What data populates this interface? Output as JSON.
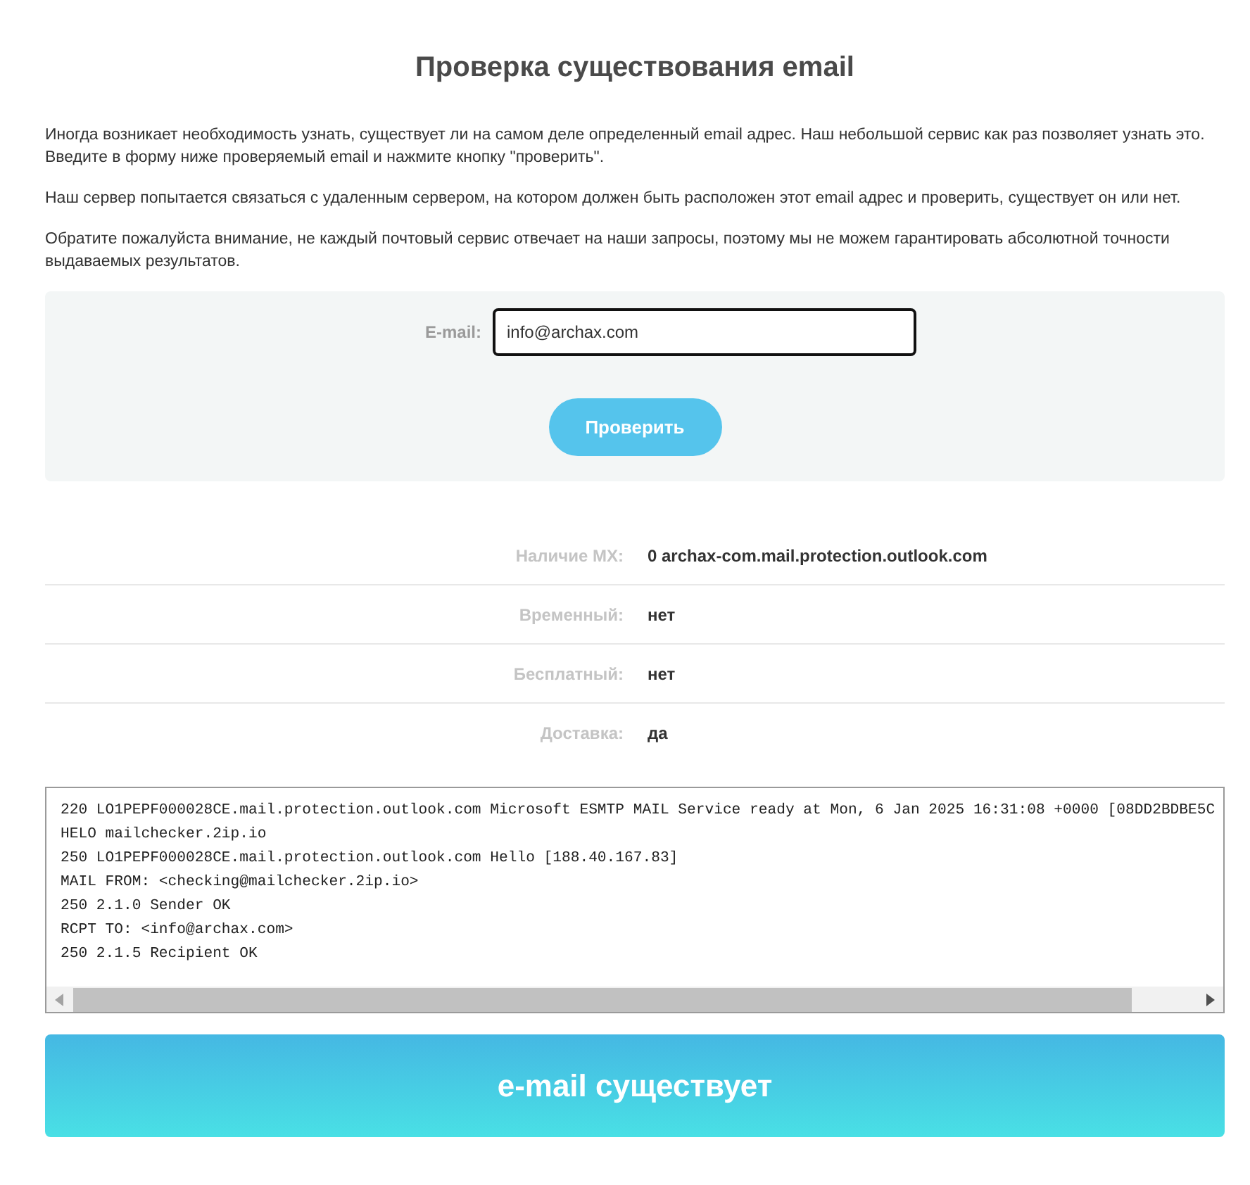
{
  "page": {
    "title": "Проверка существования email"
  },
  "intro": [
    "Иногда возникает необходимость узнать, существует ли на самом деле определенный email адрес. Наш небольшой сервис как раз позволяет узнать это. Введите в форму ниже проверяемый email и нажмите кнопку \"проверить\".",
    "Наш сервер попытается связаться с удаленным сервером, на котором должен быть расположен этот email адрес и проверить, существует он или нет.",
    "Обратите пожалуйста внимание, не каждый почтовый сервис отвечает на наши запросы, поэтому мы не можем гарантировать абсолютной точности выдаваемых результатов."
  ],
  "form": {
    "email": {
      "label": "E-mail:",
      "value": "info@archax.com"
    },
    "submit_button": "Проверить"
  },
  "results": [
    {
      "label": "Наличие MX:",
      "value": "0 archax-com.mail.protection.outlook.com"
    },
    {
      "label": "Временный:",
      "value": "нет"
    },
    {
      "label": "Бесплатный:",
      "value": "нет"
    },
    {
      "label": "Доставка:",
      "value": "да"
    }
  ],
  "smtp_log": {
    "lines": [
      "220 LO1PEPF000028CE.mail.protection.outlook.com Microsoft ESMTP MAIL Service ready at Mon, 6 Jan 2025 16:31:08 +0000 [08DD2BDBE5C",
      "HELO mailchecker.2ip.io",
      "250 LO1PEPF000028CE.mail.protection.outlook.com Hello [188.40.167.83]",
      "MAIL FROM: <checking@mailchecker.2ip.io>",
      "250 2.1.0 Sender OK",
      "RCPT TO: <info@archax.com>",
      "250 2.1.5 Recipient OK"
    ]
  },
  "verdict": {
    "text": "e-mail существует"
  }
}
